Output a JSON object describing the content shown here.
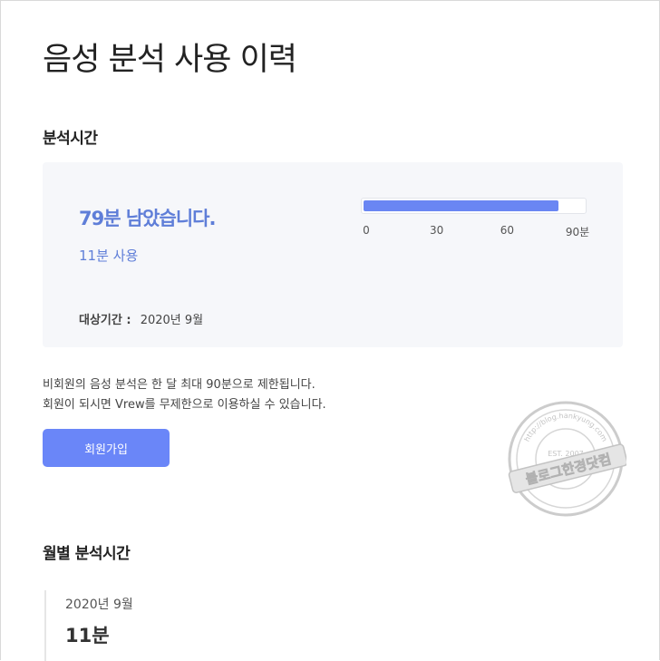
{
  "page": {
    "title": "음성 분석 사용 이력"
  },
  "analysis": {
    "heading": "분석시간",
    "remaining_text": "79분 남았습니다.",
    "used_text": "11분 사용",
    "period_label": "대상기간 :",
    "period_value": "2020년 9월",
    "progress": {
      "used_minutes": 11,
      "max_minutes": 90,
      "ticks": [
        "0",
        "30",
        "60",
        "90분"
      ]
    }
  },
  "notice": {
    "line1": "비회원의 음성 분석은 한 달 최대 90분으로 제한됩니다.",
    "line2": "회원이 되시면 Vrew를 무제한으로 이용하실 수 있습니다."
  },
  "signup": {
    "label": "회원가입"
  },
  "monthly": {
    "heading": "월별 분석시간",
    "entries": [
      {
        "date": "2020년 9월",
        "value": "11분"
      }
    ]
  },
  "watermark": {
    "main_text": "블로그한경닷컴",
    "est_text": "EST. 2007",
    "url_text": "http://blog.hankyung.com"
  },
  "colors": {
    "accent": "#6a86f8",
    "accent_text": "#5f7ed8",
    "card_bg": "#f6f7fa"
  }
}
